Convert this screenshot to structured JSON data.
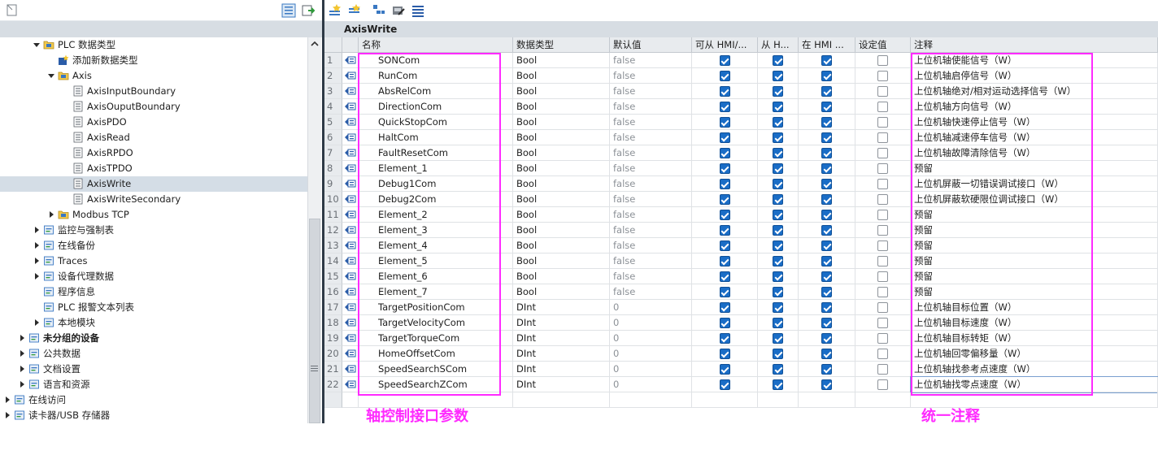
{
  "editor": {
    "title": "AxisWrite"
  },
  "tree": [
    {
      "label": "PLC 数据类型",
      "arrow": "down",
      "indent": 40,
      "icon": "folder-icon"
    },
    {
      "label": "添加新数据类型",
      "arrow": "",
      "indent": 58,
      "icon": "add-type-icon"
    },
    {
      "label": "Axis",
      "arrow": "down",
      "indent": 58,
      "icon": "folder-icon"
    },
    {
      "label": "AxisInputBoundary",
      "arrow": "",
      "indent": 76,
      "icon": "udt-icon"
    },
    {
      "label": "AxisOuputBoundary",
      "arrow": "",
      "indent": 76,
      "icon": "udt-icon"
    },
    {
      "label": "AxisPDO",
      "arrow": "",
      "indent": 76,
      "icon": "udt-icon"
    },
    {
      "label": "AxisRead",
      "arrow": "",
      "indent": 76,
      "icon": "udt-icon"
    },
    {
      "label": "AxisRPDO",
      "arrow": "",
      "indent": 76,
      "icon": "udt-icon"
    },
    {
      "label": "AxisTPDO",
      "arrow": "",
      "indent": 76,
      "icon": "udt-icon"
    },
    {
      "label": "AxisWrite",
      "arrow": "",
      "indent": 76,
      "icon": "udt-icon",
      "selected": true
    },
    {
      "label": "AxisWriteSecondary",
      "arrow": "",
      "indent": 76,
      "icon": "udt-icon"
    },
    {
      "label": "Modbus TCP",
      "arrow": "right",
      "indent": 58,
      "icon": "folder-icon"
    },
    {
      "label": "监控与强制表",
      "arrow": "right",
      "indent": 40,
      "icon": "watch-table-icon"
    },
    {
      "label": "在线备份",
      "arrow": "right",
      "indent": 40,
      "icon": "backup-icon"
    },
    {
      "label": "Traces",
      "arrow": "right",
      "indent": 40,
      "icon": "trace-icon"
    },
    {
      "label": "设备代理数据",
      "arrow": "right",
      "indent": 40,
      "icon": "proxy-data-icon"
    },
    {
      "label": "程序信息",
      "arrow": "",
      "indent": 40,
      "icon": "program-info-icon"
    },
    {
      "label": "PLC 报警文本列表",
      "arrow": "",
      "indent": 40,
      "icon": "alarm-text-icon"
    },
    {
      "label": "本地模块",
      "arrow": "right",
      "indent": 40,
      "icon": "module-icon"
    },
    {
      "label": "未分组的设备",
      "arrow": "right",
      "indent": 22,
      "icon": "ungrouped-devices-icon",
      "bold": true
    },
    {
      "label": "公共数据",
      "arrow": "right",
      "indent": 22,
      "icon": "common-data-icon"
    },
    {
      "label": "文档设置",
      "arrow": "right",
      "indent": 22,
      "icon": "document-settings-icon"
    },
    {
      "label": "语言和资源",
      "arrow": "right",
      "indent": 22,
      "icon": "language-icon"
    },
    {
      "label": "在线访问",
      "arrow": "right",
      "indent": 4,
      "icon": "online-access-icon"
    },
    {
      "label": "读卡器/USB 存储器",
      "arrow": "right",
      "indent": 4,
      "icon": "card-reader-icon"
    }
  ],
  "grid": {
    "headers": {
      "name": "名称",
      "type": "数据类型",
      "default": "默认值",
      "hmi_access": "可从 HMI/...",
      "hmi_visible": "从 H...",
      "hmi_in": "在 HMI ...",
      "setpoint": "设定值",
      "comment": "注释"
    },
    "rows": [
      {
        "n": "1",
        "name": "SONCom",
        "type": "Bool",
        "default": "false",
        "comment": "上位机轴使能信号（W）"
      },
      {
        "n": "2",
        "name": "RunCom",
        "type": "Bool",
        "default": "false",
        "comment": "上位机轴启停信号（W）"
      },
      {
        "n": "3",
        "name": "AbsRelCom",
        "type": "Bool",
        "default": "false",
        "comment": "上位机轴绝对/相对运动选择信号（W）"
      },
      {
        "n": "4",
        "name": "DirectionCom",
        "type": "Bool",
        "default": "false",
        "comment": "上位机轴方向信号（W）"
      },
      {
        "n": "5",
        "name": "QuickStopCom",
        "type": "Bool",
        "default": "false",
        "comment": "上位机轴快速停止信号（W）"
      },
      {
        "n": "6",
        "name": "HaltCom",
        "type": "Bool",
        "default": "false",
        "comment": "上位机轴减速停车信号（W）"
      },
      {
        "n": "7",
        "name": "FaultResetCom",
        "type": "Bool",
        "default": "false",
        "comment": "上位机轴故障清除信号（W）"
      },
      {
        "n": "8",
        "name": "Element_1",
        "type": "Bool",
        "default": "false",
        "comment": "预留"
      },
      {
        "n": "9",
        "name": "Debug1Com",
        "type": "Bool",
        "default": "false",
        "comment": "上位机屏蔽一切错误调试接口（W）"
      },
      {
        "n": "10",
        "name": "Debug2Com",
        "type": "Bool",
        "default": "false",
        "comment": "上位机屏蔽软硬限位调试接口（W）"
      },
      {
        "n": "11",
        "name": "Element_2",
        "type": "Bool",
        "default": "false",
        "comment": "预留"
      },
      {
        "n": "12",
        "name": "Element_3",
        "type": "Bool",
        "default": "false",
        "comment": "预留"
      },
      {
        "n": "13",
        "name": "Element_4",
        "type": "Bool",
        "default": "false",
        "comment": "预留"
      },
      {
        "n": "14",
        "name": "Element_5",
        "type": "Bool",
        "default": "false",
        "comment": "预留"
      },
      {
        "n": "15",
        "name": "Element_6",
        "type": "Bool",
        "default": "false",
        "comment": "预留"
      },
      {
        "n": "16",
        "name": "Element_7",
        "type": "Bool",
        "default": "false",
        "comment": "预留"
      },
      {
        "n": "17",
        "name": "TargetPositionCom",
        "type": "DInt",
        "default": "0",
        "comment": "上位机轴目标位置（W）"
      },
      {
        "n": "18",
        "name": "TargetVelocityCom",
        "type": "DInt",
        "default": "0",
        "comment": "上位机轴目标速度（W）"
      },
      {
        "n": "19",
        "name": "TargetTorqueCom",
        "type": "DInt",
        "default": "0",
        "comment": "上位机轴目标转矩（W）"
      },
      {
        "n": "20",
        "name": "HomeOffsetCom",
        "type": "DInt",
        "default": "0",
        "comment": "上位机轴回零偏移量（W）"
      },
      {
        "n": "21",
        "name": "SpeedSearchSCom",
        "type": "DInt",
        "default": "0",
        "comment": "上位机轴找参考点速度（W）"
      },
      {
        "n": "22",
        "name": "SpeedSearchZCom",
        "type": "DInt",
        "default": "0",
        "comment": "上位机轴找零点速度（W）"
      }
    ]
  },
  "annotations": {
    "left_label": "轴控制接口参数",
    "right_label": "统一注释",
    "color": "#ff2aff"
  },
  "colors": {
    "checkbox": "#1a6dc6",
    "header_band": "#d7dde3",
    "splitter": "#2e3a46",
    "selection": "#d4dde6"
  }
}
